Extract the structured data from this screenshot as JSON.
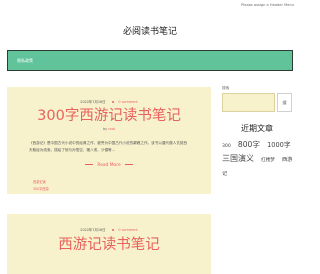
{
  "top_menu": "Please assign a Header Menu",
  "site_title": "必阅读书笔记",
  "nav": {
    "home": "隐私政策"
  },
  "posts": [
    {
      "date": "2022年7月16日",
      "comment": "0 comment",
      "title": "300字西游记读书笔记",
      "author_prefix": "by",
      "author": "root",
      "excerpt": "《西游记》是中国古代小说中的经典之作，被誉为中国古代小说的巅峰之作。该书以唐代僧人玄奘西天取经为线索，描绘了他与孙悟空、猪八戒、沙僧等...",
      "read_more": "Read More",
      "tags": [
        "西游记读",
        "300字西游"
      ]
    },
    {
      "date": "2022年7月16日",
      "comment": "0 comment",
      "title": "西游记读书笔记"
    }
  ],
  "sidebar": {
    "search_label": "搜索",
    "search_button": "搜",
    "recent_title": "近期文章",
    "tags": [
      "300",
      "800字",
      "1000字",
      "三国演义",
      "红楼梦",
      "西游记"
    ]
  },
  "colors": {
    "accent": "#e8615d",
    "nav": "#60c39a",
    "card": "#f7f2cc"
  }
}
